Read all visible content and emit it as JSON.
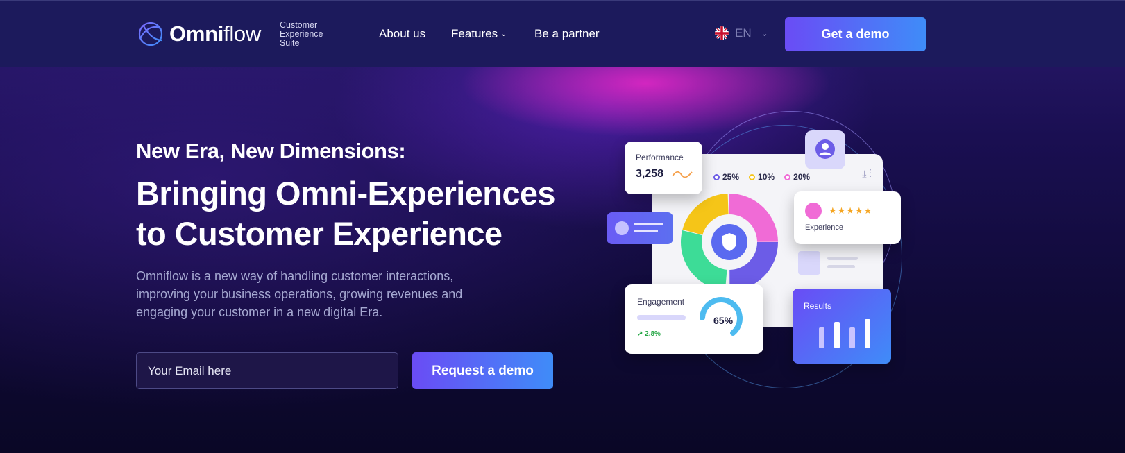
{
  "brand": {
    "name_bold": "Omni",
    "name_light": "flow",
    "tagline": [
      "Customer",
      "Experience",
      "Suite"
    ],
    "colors": {
      "accent_start": "#6a4cf5",
      "accent_end": "#3f8cf8",
      "nav_bg": "#1c1a5c"
    }
  },
  "nav": {
    "items": [
      {
        "label": "About us"
      },
      {
        "label": "Features",
        "has_dropdown": true
      },
      {
        "label": "Be a partner"
      }
    ],
    "language": {
      "code": "EN",
      "flag": "uk-flag-icon"
    },
    "cta_label": "Get a demo"
  },
  "hero": {
    "kicker": "New Era, New Dimensions:",
    "title_line1": "Bringing Omni-Experiences",
    "title_line2": "to Customer Experience",
    "description": "Omniflow is a new way of handling customer interactions, improving your business operations, growing revenues and engaging your customer in a new digital Era.",
    "email_placeholder": "Your Email here",
    "request_label": "Request a demo"
  },
  "illustration": {
    "performance": {
      "label": "Performance",
      "value": "3,258"
    },
    "legend": [
      {
        "pct": "25%",
        "color": "#6c5ce7"
      },
      {
        "pct": "10%",
        "color": "#f5c518"
      },
      {
        "pct": "20%",
        "color": "#f06bd6"
      }
    ],
    "experience": {
      "label": "Experience",
      "stars": "★★★★★"
    },
    "engagement": {
      "label": "Engagement",
      "pct": "65%",
      "trend": "↗ 2.8%"
    },
    "results": {
      "label": "Results"
    }
  }
}
